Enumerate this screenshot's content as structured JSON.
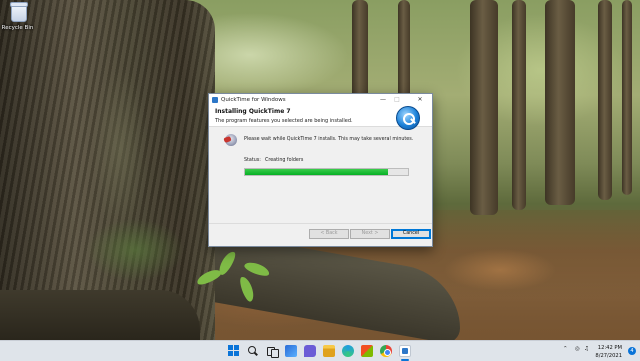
{
  "desktop": {
    "icons": [
      {
        "label": "Recycle Bin"
      }
    ]
  },
  "installer": {
    "window_title": "QuickTime for Windows",
    "heading": "Installing QuickTime 7",
    "subheading": "The program features you selected are being installed.",
    "message": "Please wait while QuickTime 7 installs. This may take several minutes.",
    "status_label": "Status:",
    "status_value": "Creating folders",
    "progress_fraction": 0.88,
    "buttons": {
      "back": "< Back",
      "next": "Next >",
      "cancel": "Cancel"
    },
    "accent_color": "#06b025"
  },
  "taskbar": {
    "apps": [
      "start-icon",
      "search-icon",
      "task-view-icon",
      "widgets-icon",
      "chat-icon",
      "file-explorer-icon",
      "edge-icon",
      "store-icon",
      "chrome-icon",
      "installer-icon"
    ],
    "clock": {
      "time": "12:42 PM",
      "date": "8/27/2021"
    },
    "notification_count": "4"
  }
}
